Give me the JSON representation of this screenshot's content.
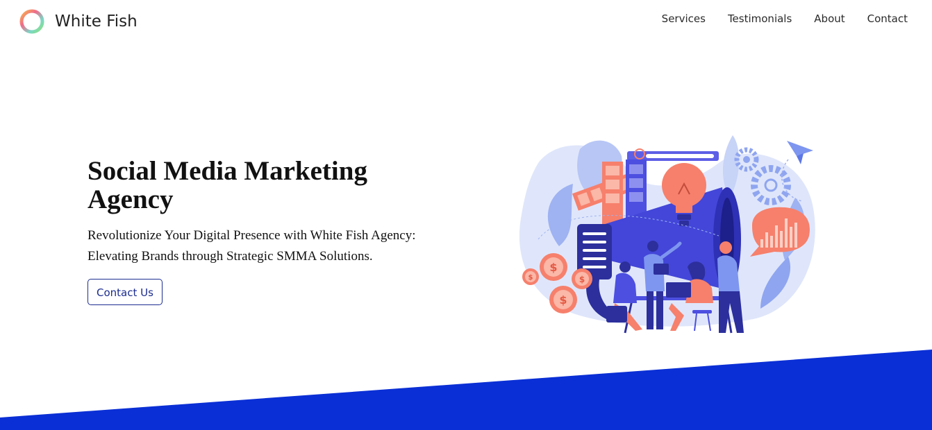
{
  "brand": {
    "name": "White Fish",
    "logo_icon": "gradient-ring-icon"
  },
  "nav": {
    "items": [
      {
        "label": "Services"
      },
      {
        "label": "Testimonials"
      },
      {
        "label": "About"
      },
      {
        "label": "Contact"
      }
    ]
  },
  "hero": {
    "title": "Social Media Marketing Agency",
    "subtitle": "Revolutionize Your Digital Presence with White Fish Agency: Elevating Brands through Strategic SMMA Solutions.",
    "cta_label": "Contact Us",
    "illustration_icon": "marketing-team-megaphone-illustration"
  },
  "colors": {
    "accent_blue": "#0a2fd6",
    "cta_border": "#1b2c8f",
    "coral": "#f6806c",
    "indigo": "#4c4fe0",
    "light_blue": "#dfe6fb"
  }
}
